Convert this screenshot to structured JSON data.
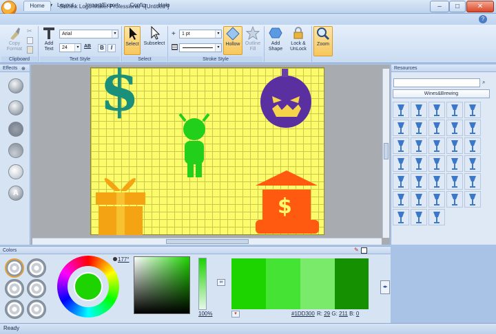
{
  "app": {
    "title": "Sothink Logo Maker Professional - [Untitled*]"
  },
  "tabs": [
    "Home",
    "Layout",
    "Import/Export",
    "Config",
    "Help"
  ],
  "ribbon": {
    "clipboard": {
      "copy_format": "Copy Format",
      "label": "Clipboard"
    },
    "text": {
      "add_text": "Add Text",
      "font": "Arial",
      "size": "24",
      "ab": "AB",
      "bold": "B",
      "italic": "I",
      "label": "Text Style"
    },
    "select": {
      "select": "Select",
      "subselect": "Subselect",
      "label": "Select"
    },
    "stroke": {
      "width": "1 pt",
      "hollow": "Hollow",
      "outline_fill": "Outline Fill",
      "label": "Stroke Style"
    },
    "shape": {
      "add_shape": "Add Shape",
      "lock": "Lock & UnLock",
      "zoom": "Zoom"
    }
  },
  "panels": {
    "effects": "Effects",
    "resources": "Resources",
    "colors": "Colors"
  },
  "resources": {
    "category": "Wines&Brewing"
  },
  "colors": {
    "angle": "177°",
    "percent": "100",
    "percent_unit": "%",
    "hex": "#1DD300",
    "r_label": "R:",
    "r": "29",
    "g_label": "G:",
    "g": "211",
    "b_label": "B:",
    "b": "0",
    "swatches": [
      "#1dd300",
      "#45e334",
      "#7aea6a",
      "#149000"
    ],
    "accent": "#1dd300"
  },
  "status": "Ready"
}
